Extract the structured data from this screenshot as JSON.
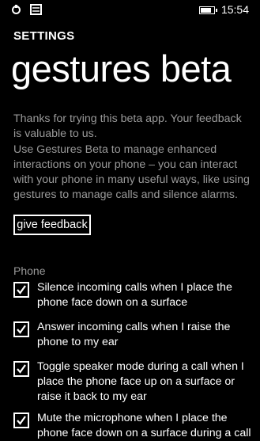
{
  "status_bar": {
    "time": "15:54",
    "battery_level": 0.9,
    "icons": [
      "notification-icon",
      "message-icon",
      "battery-icon"
    ]
  },
  "app_title": "SETTINGS",
  "page_title": "gestures beta",
  "intro_text": "Thanks for trying this beta app. Your feedback is valuable to us.",
  "description_text": "Use Gestures Beta to manage enhanced interactions on your phone – you can interact with your phone in many useful ways, like using gestures to manage calls and silence alarms.",
  "feedback_button_label": "give feedback",
  "phone_section": {
    "header": "Phone",
    "options": [
      {
        "label": "Silence incoming calls when I place the phone face down on a surface",
        "checked": true
      },
      {
        "label": "Answer incoming calls when I raise the phone to my ear",
        "checked": true
      },
      {
        "label": "Toggle speaker mode during a call when I place the phone face up on a surface or raise it back to my ear",
        "checked": true
      },
      {
        "label": "Mute the microphone when I place the phone face down on a surface during a call",
        "checked": true
      }
    ]
  },
  "colors": {
    "background": "#000000",
    "text": "#ffffff",
    "secondary_text": "#9a9a9a"
  }
}
